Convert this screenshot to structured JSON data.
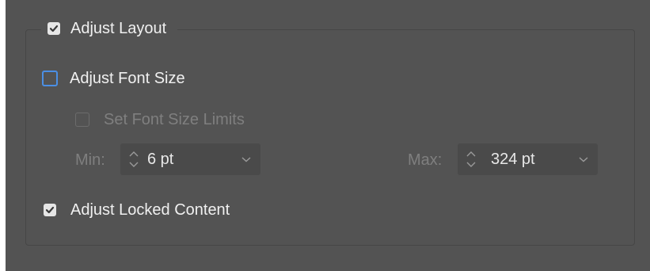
{
  "adjust_layout": {
    "label": "Adjust Layout",
    "checked": true
  },
  "adjust_font_size": {
    "label": "Adjust Font Size",
    "checked": false
  },
  "set_font_size_limits": {
    "label": "Set Font Size Limits",
    "checked": false,
    "enabled": false
  },
  "min": {
    "label": "Min:",
    "value": "6 pt"
  },
  "max": {
    "label": "Max:",
    "value": "324 pt"
  },
  "adjust_locked_content": {
    "label": "Adjust Locked Content",
    "checked": true
  },
  "colors": {
    "panel_bg": "#535353",
    "focus_blue": "#4b8fe4",
    "text": "#f0f0f0",
    "text_disabled": "#7f7f7f"
  },
  "icons": {
    "checkmark": "checkmark-icon",
    "stepper": "stepper-arrows-icon",
    "dropdown": "chevron-down-icon"
  }
}
